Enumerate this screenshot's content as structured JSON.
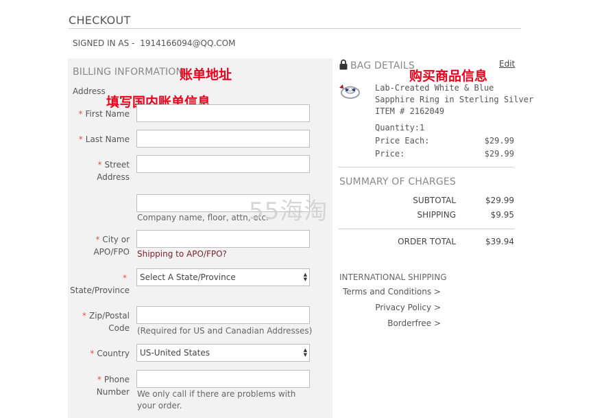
{
  "header": {
    "title": "CHECKOUT",
    "signed_in_label": "SIGNED IN AS -",
    "signed_in_email": "1914166094@QQ.COM"
  },
  "billing": {
    "title": "BILLING INFORMATION",
    "annotation_title": "账单地址",
    "address_label": "Address",
    "annotation_address": "填写国内账单信息",
    "first_name_label": "First Name",
    "last_name_label": "Last Name",
    "street_label_1": "Street",
    "street_label_2": "Address",
    "address2_hint": "Company name, floor, attn, etc.",
    "city_label_1": "City or",
    "city_label_2": "APO/FPO",
    "apo_link": "Shipping to APO/FPO?",
    "state_label": "State/Province",
    "state_value": "Select A State/Province",
    "zip_label_1": "Zip/Postal",
    "zip_label_2": "Code",
    "zip_hint": "(Required for US and Canadian Addresses)",
    "country_label": "Country",
    "country_value": "US-United States",
    "phone_label_1": "Phone",
    "phone_label_2": "Number",
    "phone_hint_1": "We only call if there are problems with",
    "phone_hint_2": "your order.",
    "required_mark": "*"
  },
  "bag": {
    "title": "BAG DETAILS",
    "annotation": "购买商品信息",
    "edit": "Edit",
    "item_line1": "Lab-Created White & Blue",
    "item_line2": "Sapphire Ring in Sterling Silver",
    "item_number": "ITEM # 2162049",
    "quantity": "Quantity:1",
    "price_each_label": "Price Each:",
    "price_each": "$29.99",
    "price_label": "Price:",
    "price": "$29.99"
  },
  "summary": {
    "title": "SUMMARY OF CHARGES",
    "subtotal_label": "SUBTOTAL",
    "subtotal": "$29.99",
    "shipping_label": "SHIPPING",
    "shipping": "$9.95",
    "order_total_label": "ORDER TOTAL",
    "order_total": "$39.94"
  },
  "international": {
    "title": "INTERNATIONAL SHIPPING",
    "links": [
      "Terms and Conditions >",
      "Privacy Policy >",
      "Borderfree >"
    ]
  },
  "watermark": "55海淘",
  "colors": {
    "annotation": "#e8001c",
    "required": "#d9534f",
    "panel": "#f2f2f2",
    "link": "#7a1e2b"
  },
  "icons": [
    "lock-icon",
    "ring-thumbnail"
  ]
}
